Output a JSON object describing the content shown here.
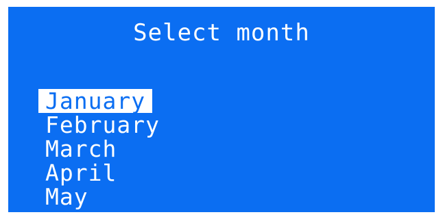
{
  "title": "Select month",
  "months": [
    {
      "label": "January",
      "selected": true
    },
    {
      "label": "February",
      "selected": false
    },
    {
      "label": "March",
      "selected": false
    },
    {
      "label": "April",
      "selected": false
    },
    {
      "label": "May",
      "selected": false
    }
  ],
  "colors": {
    "background": "#0b6ef2",
    "text": "#ffffff",
    "highlight_bg": "#ffffff",
    "highlight_text": "#0b6ef2"
  }
}
